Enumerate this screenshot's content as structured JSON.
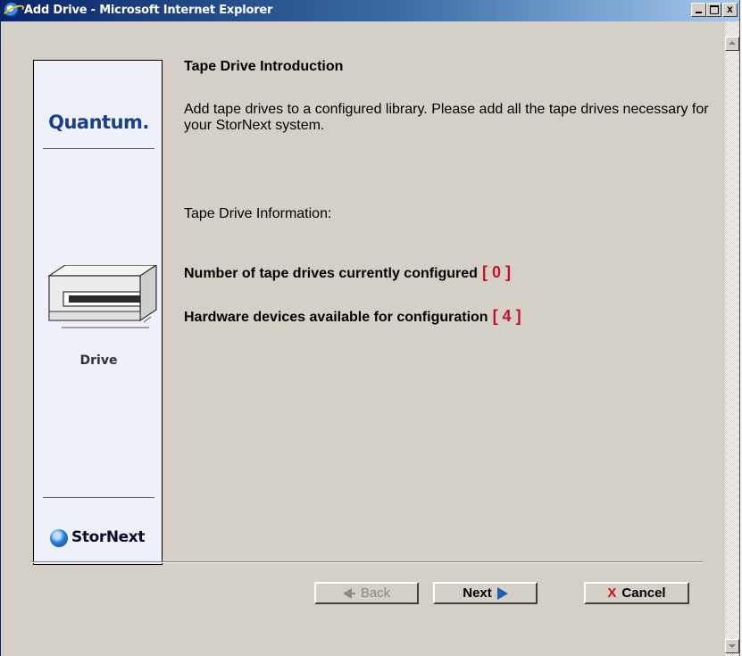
{
  "window": {
    "title": "Add Drive - Microsoft Internet Explorer",
    "controls": [
      "minimize",
      "maximize",
      "close"
    ],
    "close_glyph": "x"
  },
  "sidebar": {
    "brand": "Quantum.",
    "drive_label": "Drive",
    "product": "StorNext",
    "drive_icon": "tape-drive-icon",
    "product_icon": "globe-icon"
  },
  "main": {
    "heading": "Tape Drive Introduction",
    "intro": "Add tape drives to a configured library. Please add all the tape drives necessary for your StorNext system.",
    "info_label": "Tape Drive Information:",
    "stats": [
      {
        "label": "Number of tape drives currently configured",
        "value": "[ 0 ]"
      },
      {
        "label": "Hardware devices available for configuration",
        "value": "[ 4 ]"
      }
    ]
  },
  "buttons": {
    "back": "Back",
    "next": "Next",
    "cancel": "Cancel",
    "back_icon": "arrow-left-icon",
    "next_icon": "arrow-right-icon",
    "cancel_icon": "x-icon"
  },
  "colors": {
    "titlebar_start": "#0a246a",
    "titlebar_end": "#a6caf0",
    "accent_red": "#c8102e",
    "brand_blue": "#1c3f87"
  }
}
